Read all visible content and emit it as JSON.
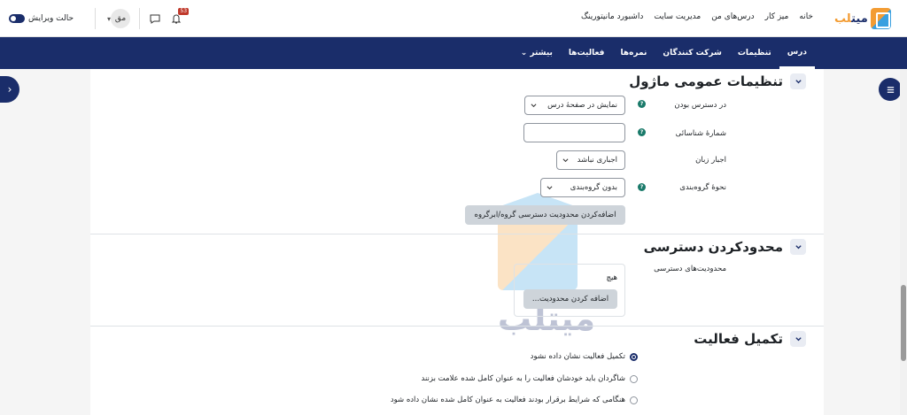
{
  "brand": {
    "logo_main": "میت",
    "logo_accent": "لب"
  },
  "topnav": {
    "items": [
      "خانه",
      "میز کار",
      "درس‌های من",
      "مدیریت سایت",
      "داشبورد مانیتورینگ"
    ]
  },
  "user": {
    "initials": "مق",
    "edit_mode_label": "حالت ویرایش",
    "notifications_count": "53"
  },
  "secnav": {
    "items": [
      "درس",
      "تنظیمات",
      "شرکت کنندگان",
      "نمره‌ها",
      "فعالیت‌ها",
      "بیشتر ⌄"
    ],
    "active_index": 0
  },
  "general": {
    "title": "تنظیمات عمومی ماژول",
    "availability_label": "در دسترس بودن",
    "availability_value": "نمایش در صفحهٔ درس",
    "idnumber_label": "شمارهٔ شناسائی",
    "idnumber_value": "",
    "lang_label": "اجبار زبان",
    "lang_value": "اجباری نباشد",
    "groupmode_label": "نحوهٔ گروه‌بندی",
    "groupmode_value": "بدون گروه‌بندی",
    "group_restriction_button": "اضافه‌کردن محدودیت دسترسی گروه/ابرگروه"
  },
  "restrict": {
    "title": "محدودکردن دسترسی",
    "label": "محدودیت‌های دسترسی",
    "none_text": "هیچ",
    "add_button": "اضافه کردن محدودیت..."
  },
  "completion": {
    "title": "تکمیل فعالیت",
    "options": [
      {
        "label": "تکمیل فعالیت نشان داده نشود",
        "checked": true
      },
      {
        "label": "شاگردان باید خودشان فعالیت را به عنوان کامل شده علامت بزنند",
        "checked": false
      },
      {
        "label": "هنگامی که شرایط برقرار بودند فعالیت به عنوان کامل شده نشان داده شود",
        "checked": false
      }
    ]
  },
  "help_glyph": "?",
  "colors": {
    "primary": "#1a2d6a",
    "accent": "#f39c33",
    "secondary": "#3aa0e0"
  }
}
